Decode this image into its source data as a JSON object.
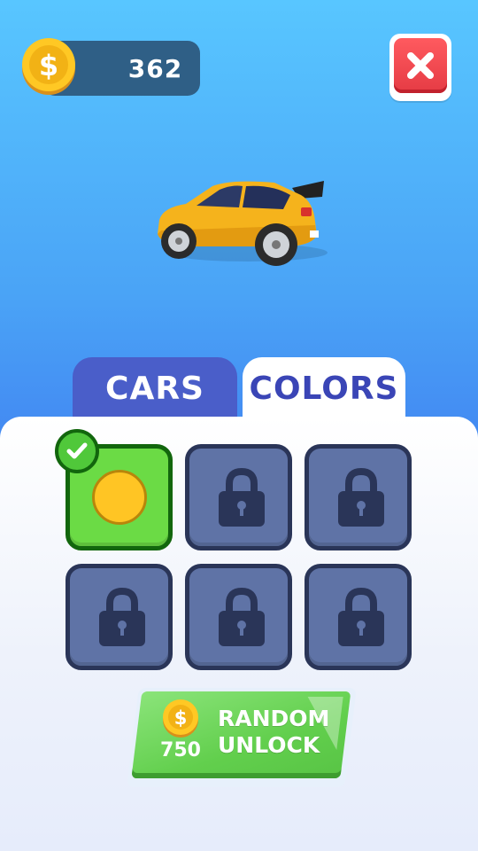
{
  "hud": {
    "coins": "362",
    "coin_icon": "dollar-coin-icon",
    "close_icon": "close-x-icon"
  },
  "preview": {
    "car_color": "#f6b21c"
  },
  "tabs": [
    {
      "label": "CARS",
      "active": false
    },
    {
      "label": "COLORS",
      "active": true
    }
  ],
  "colors_grid": {
    "slots": [
      {
        "state": "selected",
        "color": "#ffc524"
      },
      {
        "state": "locked",
        "icon": "lock-icon"
      },
      {
        "state": "locked",
        "icon": "lock-icon"
      },
      {
        "state": "locked",
        "icon": "lock-icon"
      },
      {
        "state": "locked",
        "icon": "lock-icon"
      },
      {
        "state": "locked",
        "icon": "lock-icon"
      }
    ],
    "selected_indicator": "checkmark-icon"
  },
  "random_unlock": {
    "price": "750",
    "label_line1": "RANDOM",
    "label_line2": "UNLOCK"
  },
  "theme": {
    "accent_green": "#62cf4d",
    "locked_slot": "#5f73a6",
    "tab_blue": "#4a5ec9",
    "close_red": "#e53b44"
  }
}
